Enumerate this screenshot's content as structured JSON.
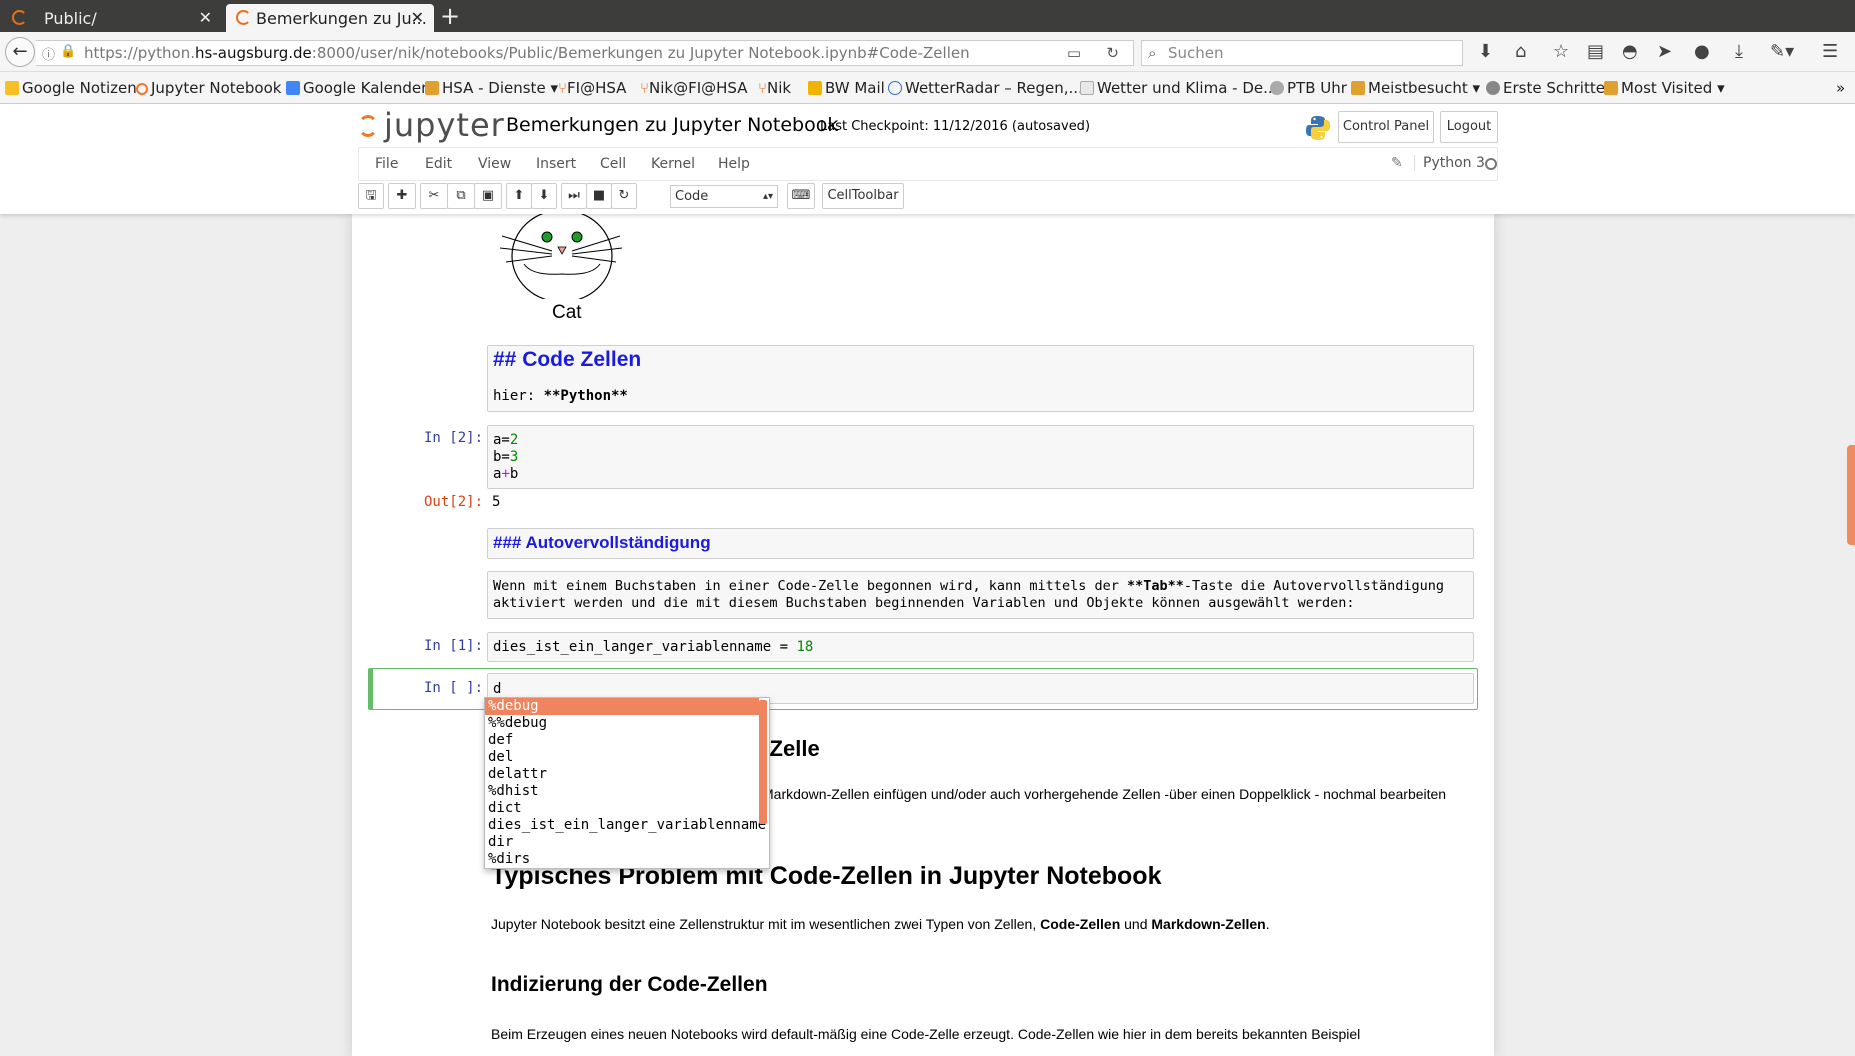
{
  "browser": {
    "tabs": [
      {
        "title": "Public/"
      },
      {
        "title": "Bemerkungen zu Ju..."
      }
    ],
    "url_prefix": "https://python.",
    "url_host": "hs-augsburg.de",
    "url_rest": ":8000/user/nik/notebooks/Public/Bemerkungen zu Jupyter Notebook.ipynb#Code-Zellen",
    "search_placeholder": "Suchen",
    "bookmarks": [
      "Google Notizen",
      "Jupyter Notebook",
      "Google Kalender",
      "HSA - Dienste",
      "FI@HSA",
      "Nik@FI@HSA",
      "Nik",
      "BW Mail",
      "WetterRadar – Regen,...",
      "Wetter und Klima - De...",
      "PTB Uhr",
      "Meistbesucht",
      "Erste Schritte",
      "Most Visited"
    ]
  },
  "jupyter": {
    "logo_text": "jupyter",
    "notebook_title": "Bemerkungen zu Jupyter Notebook",
    "checkpoint": "Last Checkpoint: 11/12/2016 (autosaved)",
    "control_panel_label": "Control Panel",
    "logout_label": "Logout",
    "menu": [
      "File",
      "Edit",
      "View",
      "Insert",
      "Cell",
      "Kernel",
      "Help"
    ],
    "kernel_name": "Python 3",
    "cell_type": "Code",
    "celltoolbar_label": "CellToolbar"
  },
  "notebook": {
    "cat_caption": "Cat",
    "md_code_zellen": "## Code Zellen",
    "md_hier_prefix": "hier: ",
    "md_hier_bold": "**Python**",
    "cell2_prompt": "In [2]:",
    "cell2_lines": {
      "l1a": "a=",
      "l1b": "2",
      "l2a": "b=",
      "l2b": "3",
      "l3a": "a",
      "l3op": "+",
      "l3b": "b"
    },
    "out2_prompt": "Out[2]:",
    "out2_value": "5",
    "md_autovervoll": "### Autovervollständigung",
    "md_wenn_line1_a": "Wenn mit einem Buchstaben in einer Code-Zelle begonnen wird, kann mittels der ",
    "md_wenn_line1_b": "**Tab**",
    "md_wenn_line1_c": "-Taste die Autovervollständigung",
    "md_wenn_line2": "aktiviert werden und die mit diesem Buchstaben beginnenden Variablen und Objekte können ausgewählt werden:",
    "cell1_prompt": "In [1]:",
    "cell1_code": "dies_ist_ein_langer_variablenname = ",
    "cell1_num": "18",
    "active_prompt": "In [ ]:",
    "active_code": "d",
    "autocomplete": [
      "%debug",
      "%%debug",
      "def",
      "del",
      "delattr",
      "%dhist",
      "dict",
      "dies_ist_ein_langer_variablenname",
      "dir",
      "%dirs"
    ],
    "partial_heading": "n Zelle",
    "partial_text": "Markdown-Zellen einfügen und/oder auch vorhergehende Zellen -über einen Doppelklick - nochmal bearbeiten",
    "h1_typisch": "Typisches Problem mit Code-Zellen in Jupyter Notebook",
    "p_jupyter_a": "Jupyter Notebook besitzt eine Zellenstruktur mit im wesentlichen zwei Typen von Zellen, ",
    "p_jupyter_b": "Code-Zellen",
    "p_jupyter_c": " und ",
    "p_jupyter_d": "Markdown-Zellen",
    "p_jupyter_e": ".",
    "h2_indizierung": "Indizierung der Code-Zellen",
    "p_beim": "Beim Erzeugen eines neuen Notebooks wird default-mäßig eine Code-Zelle erzeugt. Code-Zellen wie hier in dem bereits bekannten Beispiel"
  },
  "colors": {
    "accent": "#f37726",
    "autocomplete_selected": "#ef845f",
    "markdown_heading": "#1a1ae0",
    "in_prompt": "#303f9f",
    "out_prompt": "#d84315",
    "active_cell_border": "#66bb6a"
  }
}
